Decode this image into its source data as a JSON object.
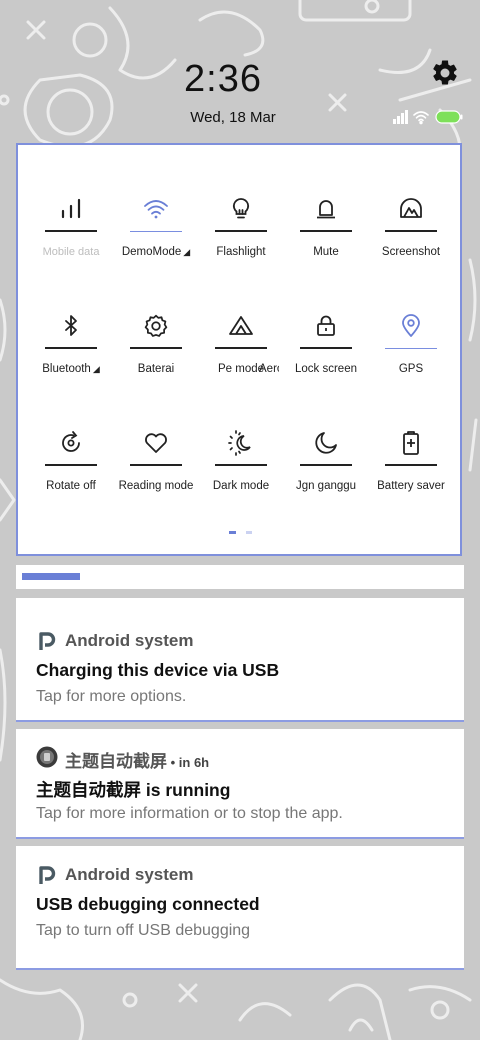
{
  "status": {
    "time": "2:36",
    "date": "Wed, 18 Mar"
  },
  "tiles": [
    {
      "label": "Mobile data",
      "icon": "signal-bars-icon",
      "state": "disabled"
    },
    {
      "label": "DemoMode",
      "icon": "wifi-icon",
      "state": "active",
      "has_dropdown": true
    },
    {
      "label": "Flashlight",
      "icon": "lightbulb-icon",
      "state": "off"
    },
    {
      "label": "Mute",
      "icon": "bell-icon",
      "state": "off"
    },
    {
      "label": "Screenshot",
      "icon": "screenshot-icon",
      "state": "off"
    },
    {
      "label": "Bluetooth",
      "icon": "bluetooth-icon",
      "state": "off",
      "has_dropdown": true
    },
    {
      "label": "Baterai",
      "icon": "gear-icon",
      "state": "off"
    },
    {
      "label": "Pe  mode",
      "icon": "triangle-icon",
      "state": "off"
    },
    {
      "label": "Aero",
      "icon": "airplane-icon",
      "state": "off"
    },
    {
      "label": "Lock screen",
      "icon": "lock-icon",
      "state": "off"
    },
    {
      "label": "GPS",
      "icon": "location-pin-icon",
      "state": "active"
    },
    {
      "label": "Rotate off",
      "icon": "rotate-icon",
      "state": "off"
    },
    {
      "label": "Reading mode",
      "icon": "heart-icon",
      "state": "off"
    },
    {
      "label": "Dark mode",
      "icon": "sun-moon-icon",
      "state": "off"
    },
    {
      "label": "Jgn ganggu",
      "icon": "moon-icon",
      "state": "off"
    },
    {
      "label": "Battery saver",
      "icon": "battery-plus-icon",
      "state": "off"
    }
  ],
  "notifications": [
    {
      "app": "Android system",
      "meta": "",
      "title": "Charging this device via USB",
      "text": "Tap for more options."
    },
    {
      "app": "主题自动截屏",
      "meta": " • in 6h",
      "title": "主题自动截屏 is running",
      "text": "Tap for more information or to stop the app."
    },
    {
      "app": "Android system",
      "meta": "",
      "title": "USB debugging connected",
      "text": "Tap to turn off USB debugging"
    }
  ],
  "colors": {
    "accent": "#6a7fd6",
    "panel_border": "#7f90dc",
    "battery": "#7ee05a",
    "background": "#c9c9c9"
  }
}
